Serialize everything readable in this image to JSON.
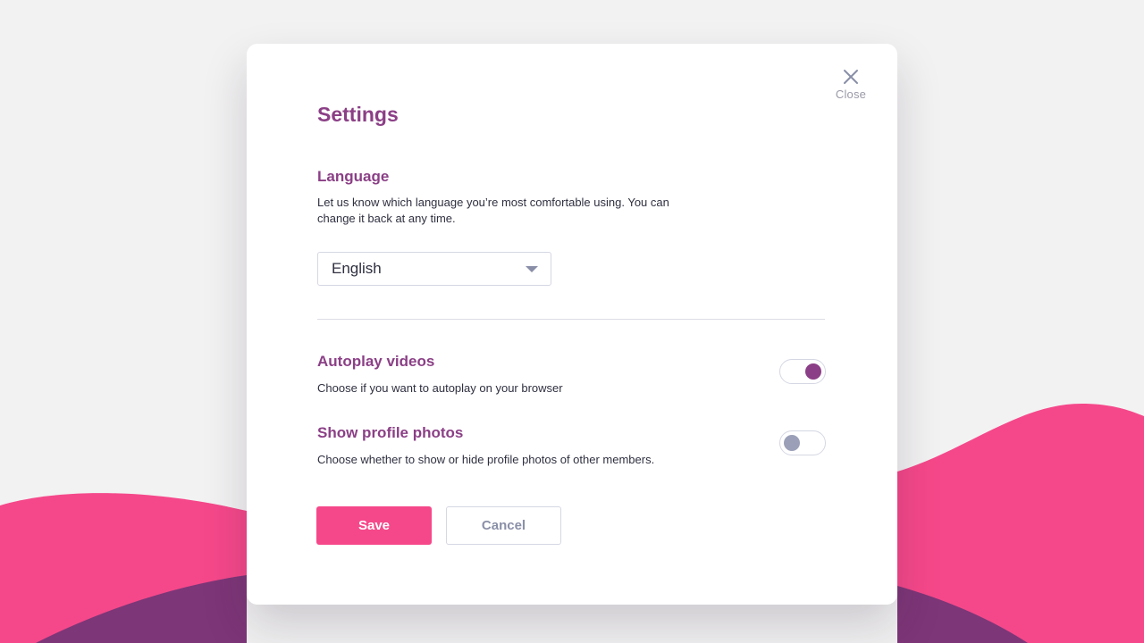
{
  "modal": {
    "title": "Settings",
    "close_label": "Close",
    "close_icon": "close-icon"
  },
  "language": {
    "heading": "Language",
    "description": "Let us know which language you’re most comfortable using. You can change it back at any time.",
    "selected": "English",
    "caret_icon": "caret-down-icon"
  },
  "autoplay": {
    "heading": "Autoplay videos",
    "description": "Choose if you want to autoplay on your browser",
    "enabled": true
  },
  "profile_photos": {
    "heading": "Show profile photos",
    "description": "Choose whether to show or hide profile photos of other members.",
    "enabled": false
  },
  "actions": {
    "save_label": "Save",
    "cancel_label": "Cancel"
  },
  "colors": {
    "accent_purple": "#8b3f86",
    "accent_pink": "#f5488a",
    "background": "#f2f2f2",
    "wave_pink": "#f5488a",
    "wave_purple": "#7d3678"
  }
}
